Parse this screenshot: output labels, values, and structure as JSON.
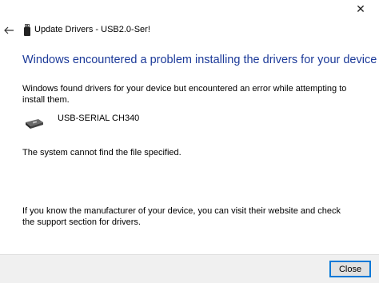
{
  "window": {
    "title": "Update Drivers - USB2.0-Ser!",
    "close_glyph": "✕"
  },
  "header": {
    "back_icon": "back-arrow-icon",
    "device_icon": "usb-device-icon"
  },
  "main": {
    "heading": "Windows encountered a problem installing the drivers for your device",
    "description": "Windows found drivers for your device but encountered an error while attempting to install them.",
    "device_name": "USB-SERIAL CH340",
    "error_message": "The system cannot find the file specified.",
    "footer_note": "If you know the manufacturer of your device, you can visit their website and check the support section for drivers."
  },
  "footer": {
    "close_label": "Close"
  },
  "colors": {
    "heading": "#1c3a99",
    "button_border": "#0078d7",
    "footer_bg": "#f0f0f0"
  }
}
